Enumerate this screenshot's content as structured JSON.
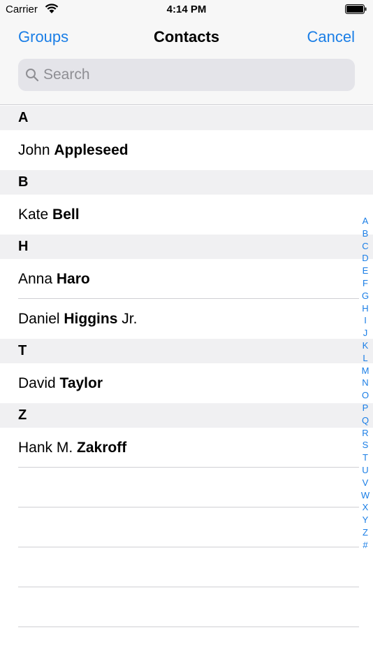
{
  "status_bar": {
    "carrier": "Carrier",
    "time": "4:14 PM"
  },
  "nav": {
    "left_label": "Groups",
    "title": "Contacts",
    "right_label": "Cancel"
  },
  "search": {
    "placeholder": "Search",
    "value": ""
  },
  "sections": [
    {
      "letter": "A",
      "contacts": [
        {
          "first": "John",
          "last": "Appleseed",
          "suffix": ""
        }
      ]
    },
    {
      "letter": "B",
      "contacts": [
        {
          "first": "Kate",
          "last": "Bell",
          "suffix": ""
        }
      ]
    },
    {
      "letter": "H",
      "contacts": [
        {
          "first": "Anna",
          "last": "Haro",
          "suffix": ""
        },
        {
          "first": "Daniel",
          "last": "Higgins",
          "suffix": "Jr."
        }
      ]
    },
    {
      "letter": "T",
      "contacts": [
        {
          "first": "David",
          "last": "Taylor",
          "suffix": ""
        }
      ]
    },
    {
      "letter": "Z",
      "contacts": [
        {
          "first": "Hank M.",
          "last": "Zakroff",
          "suffix": ""
        }
      ]
    }
  ],
  "index_letters": [
    "A",
    "B",
    "C",
    "D",
    "E",
    "F",
    "G",
    "H",
    "I",
    "J",
    "K",
    "L",
    "M",
    "N",
    "O",
    "P",
    "Q",
    "R",
    "S",
    "T",
    "U",
    "V",
    "W",
    "X",
    "Y",
    "Z",
    "#"
  ],
  "colors": {
    "accent": "#1a7ee6",
    "section_bg": "#f0f0f2",
    "bar_bg": "#f7f7f7"
  },
  "icons": {
    "search": "search-icon",
    "wifi": "wifi-icon",
    "battery": "battery-icon"
  }
}
